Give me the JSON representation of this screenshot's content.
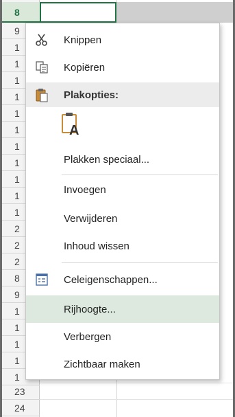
{
  "sheet": {
    "row_numbers": [
      "8",
      "9",
      "1",
      "1",
      "1",
      "1",
      "1",
      "1",
      "1",
      "1",
      "1",
      "1",
      "1",
      "2",
      "2",
      "2",
      "23",
      "24"
    ]
  },
  "menu": {
    "items": [
      {
        "label": "Knippen",
        "icon": "scissors-icon"
      },
      {
        "label": "Kopiëren",
        "icon": "copy-icon"
      },
      {
        "label": "Plakopties:",
        "icon": "clipboard-icon"
      },
      {
        "label": "",
        "icon": "paste-text-only-icon"
      },
      {
        "label": "Plakken speciaal...",
        "icon": ""
      },
      {
        "label": "Invoegen",
        "icon": ""
      },
      {
        "label": "Verwijderen",
        "icon": ""
      },
      {
        "label": "Inhoud wissen",
        "icon": ""
      },
      {
        "label": "Celeigenschappen...",
        "icon": "format-cells-icon"
      },
      {
        "label": "Rijhoogte...",
        "icon": ""
      },
      {
        "label": "Verbergen",
        "icon": ""
      },
      {
        "label": "Zichtbaar maken",
        "icon": ""
      }
    ]
  },
  "colors": {
    "accent": "#217346",
    "hover": "#dde9df"
  }
}
